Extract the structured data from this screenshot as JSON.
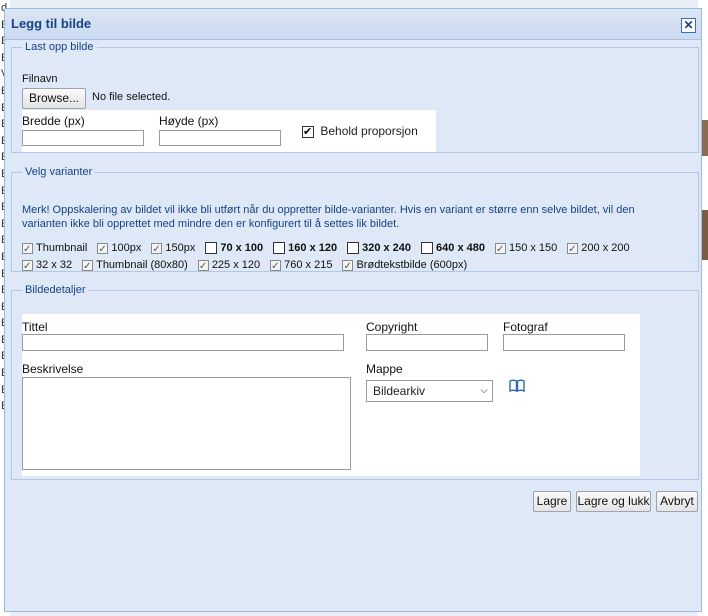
{
  "background": {
    "left_letters": [
      "d",
      "E",
      "E",
      "E",
      "V",
      "E",
      "E",
      "E",
      "E",
      "E",
      "E",
      "E",
      "E",
      "E",
      "E",
      "E",
      "E",
      "E",
      "E",
      "E",
      "E",
      "E",
      "E",
      "E",
      "E"
    ]
  },
  "dialog": {
    "title": "Legg til bilde",
    "close_glyph": "✕"
  },
  "upload": {
    "legend": "Last opp bilde",
    "filename_label": "Filnavn",
    "browse_label": "Browse...",
    "file_status": "No file selected.",
    "width_label": "Bredde (px)",
    "width_value": "",
    "height_label": "Høyde (px)",
    "height_value": "",
    "keep_ratio_label": "Behold proporsjon",
    "keep_ratio_checked": true
  },
  "variants": {
    "legend": "Velg varianter",
    "note": "Merk! Oppskalering av bildet vil ikke bli utført når du oppretter bilde-varianter. Hvis en variant er større enn selve bildet, vil den varianten ikke bli opprettet med mindre den er konfigurert til å settes lik bildet.",
    "items": [
      {
        "label": "Thumbnail",
        "checked": true,
        "bold": false
      },
      {
        "label": "100px",
        "checked": true,
        "bold": false
      },
      {
        "label": "150px",
        "checked": true,
        "bold": false
      },
      {
        "label": "70 x 100",
        "checked": false,
        "bold": true
      },
      {
        "label": "160 x 120",
        "checked": false,
        "bold": true
      },
      {
        "label": "320 x 240",
        "checked": false,
        "bold": true
      },
      {
        "label": "640 x 480",
        "checked": false,
        "bold": true
      },
      {
        "label": "150 x 150",
        "checked": true,
        "bold": false
      },
      {
        "label": "200 x 200",
        "checked": true,
        "bold": false
      },
      {
        "label": "32 x 32",
        "checked": true,
        "bold": false
      },
      {
        "label": "Thumbnail (80x80)",
        "checked": true,
        "bold": false
      },
      {
        "label": "225 x 120",
        "checked": true,
        "bold": false
      },
      {
        "label": "760 x 215",
        "checked": true,
        "bold": false
      },
      {
        "label": "Brødtekstbilde (600px)",
        "checked": true,
        "bold": false
      }
    ]
  },
  "details": {
    "legend": "Bildedetaljer",
    "title_label": "Tittel",
    "title_value": "",
    "copyright_label": "Copyright",
    "copyright_value": "",
    "photographer_label": "Fotograf",
    "photographer_value": "",
    "description_label": "Beskrivelse",
    "description_value": "",
    "folder_label": "Mappe",
    "folder_value": "Bildearkiv",
    "folder_icon": "book-icon"
  },
  "footer": {
    "save_label": "Lagre",
    "save_close_label": "Lagre og lukk",
    "cancel_label": "Avbryt"
  }
}
